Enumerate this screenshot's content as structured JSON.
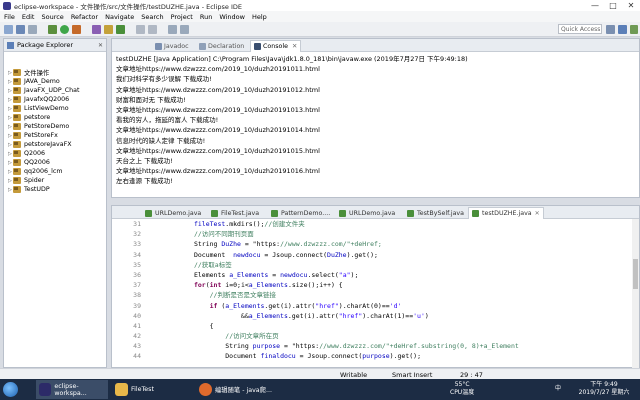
{
  "window": {
    "title": "eclipse-workspace - 文件操作/src/文件操作/testDUZHE.java - Eclipse IDE",
    "minimize": "—",
    "maximize": "□",
    "close": "✕"
  },
  "menu": [
    "File",
    "Edit",
    "Source",
    "Refactor",
    "Navigate",
    "Search",
    "Project",
    "Run",
    "Window",
    "Help"
  ],
  "toolbar": {
    "quick_access_placeholder": "Quick Access"
  },
  "explorer": {
    "title": "Package Explorer",
    "close": "✕",
    "projects": [
      "文件操作",
      "JAVA_Demo",
      "JavaFX_UDP_Chat",
      "JavafxQQ2006",
      "ListViewDemo",
      "petstore",
      "PetStoreDemo",
      "PetStoreFx",
      "petstoreJavaFX",
      "Q2006",
      "QQ2006",
      "qq2006_lcm",
      "Spider",
      "TestUDP"
    ]
  },
  "console": {
    "tabs": [
      "Javadoc",
      "Declaration",
      "Console"
    ],
    "close": "✕",
    "lines": [
      "testDUZHE [Java Application] C:\\Program Files\\Java\\jdk1.8.0_181\\bin\\javaw.exe (2019年7月27日 下午9:49:18)",
      "文章地址https://www.dzwzzz.com/2019_10/duzh20191011.html",
      "我们对科学有多少误解 下载成功!",
      "文章地址https://www.dzwzzz.com/2019_10/duzh20191012.html",
      "财富和面对无 下载成功!",
      "文章地址https://www.dzwzzz.com/2019_10/duzh20191013.html",
      "看我的穷人，拖延的富人 下载成功!",
      "文章地址https://www.dzwzzz.com/2019_10/duzh20191014.html",
      "信息时代的缺人定律 下载成功!",
      "文章地址https://www.dzwzzz.com/2019_10/duzh20191015.html",
      "天台之上 下载成功!",
      "文章地址https://www.dzwzzz.com/2019_10/duzh20191016.html",
      "左右逢源 下载成功!"
    ]
  },
  "editor": {
    "tabs": [
      "URLDemo.java",
      "FileTest.java",
      "PatternDemo....",
      "URLDemo.java",
      "TestBySelf.java",
      "testDUZHE.java"
    ],
    "close": "✕",
    "line_numbers": [
      "31",
      "32",
      "33",
      "34",
      "35",
      "36",
      "37",
      "38",
      "39",
      "40",
      "41",
      "42",
      "43",
      "44"
    ],
    "code": [
      "            fileTest.mkdirs();//创建文件夹",
      "            //访问不同期刊页面",
      "            String DuZhe = \"https://www.dzwzzz.com/\"+deHref;",
      "            Document  newdocu = Jsoup.connect(DuZhe).get();",
      "            //获取a标签",
      "            Elements a_Elements = newdocu.select(\"a\");",
      "            for(int i=0;i<a_Elements.size();i++) {",
      "                //判断是否是文章链接",
      "                if (a_Elements.get(i).attr(\"href\").charAt(0)=='d'",
      "                        &&a_Elements.get(i).attr(\"href\").charAt(1)=='u')",
      "                {",
      "                    //访问文章所在页",
      "                    String purpose = \"https://www.dzwzzz.com/\"+deHref.substring(0, 8)+a_Element",
      "                    Document finaldocu = Jsoup.connect(purpose).get();"
    ]
  },
  "status": {
    "mode": "Writable",
    "insert": "Smart Insert",
    "position": "29 : 47"
  },
  "taskbar": {
    "apps": [
      "eclipse-workspa...",
      "FileTest",
      "编辑随笔 - java爬..."
    ],
    "temp": "55°C",
    "temp_label": "CPU温度",
    "ime": "中",
    "time": "下午 9:49",
    "date": "2019/7/27 星期六"
  },
  "colors": {
    "keyword": "#7f0055",
    "comment": "#3f7f5f",
    "string": "#2a00ff",
    "field": "#0000c0",
    "taskbar": "#1c2c44"
  }
}
